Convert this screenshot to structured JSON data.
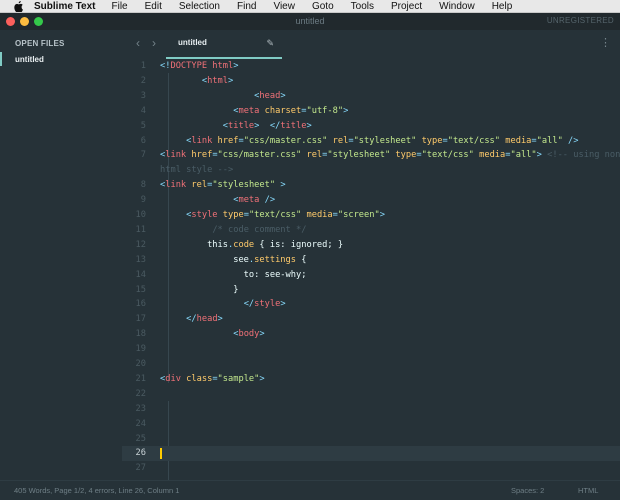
{
  "menubar": {
    "app": "Sublime Text",
    "items": [
      "File",
      "Edit",
      "Selection",
      "Find",
      "View",
      "Goto",
      "Tools",
      "Project",
      "Window",
      "Help"
    ]
  },
  "window": {
    "title": "untitled",
    "registration": "UNREGISTERED"
  },
  "sidebar": {
    "title": "OPEN FILES",
    "files": [
      "untitled"
    ]
  },
  "tab": {
    "label": "untitled"
  },
  "editor": {
    "current_line": 26,
    "lines": [
      {
        "n": "1",
        "tokens": [
          [
            "p",
            "<!"
          ],
          [
            "t",
            "DOCTYPE html"
          ],
          [
            "p",
            ">"
          ]
        ]
      },
      {
        "n": "2",
        "tokens": [
          [
            "x",
            "        "
          ],
          [
            "p",
            "<"
          ],
          [
            "t",
            "html"
          ],
          [
            "p",
            ">"
          ]
        ]
      },
      {
        "n": "3",
        "tokens": [
          [
            "x",
            "                  "
          ],
          [
            "p",
            "<"
          ],
          [
            "t",
            "head"
          ],
          [
            "p",
            ">"
          ]
        ]
      },
      {
        "n": "4",
        "tokens": [
          [
            "x",
            "              "
          ],
          [
            "p",
            "<"
          ],
          [
            "t",
            "meta "
          ],
          [
            "a",
            "charset"
          ],
          [
            "p",
            "="
          ],
          [
            "s",
            "\"utf-8\""
          ],
          [
            "p",
            ">"
          ]
        ]
      },
      {
        "n": "5",
        "tokens": [
          [
            "x",
            "            "
          ],
          [
            "p",
            "<"
          ],
          [
            "t",
            "title"
          ],
          [
            "p",
            ">  </"
          ],
          [
            "t",
            "title"
          ],
          [
            "p",
            ">"
          ]
        ]
      },
      {
        "n": "6",
        "tokens": [
          [
            "x",
            "     "
          ],
          [
            "p",
            "<"
          ],
          [
            "t",
            "link "
          ],
          [
            "a",
            "href"
          ],
          [
            "p",
            "="
          ],
          [
            "s",
            "\"css/master.css\""
          ],
          [
            "x",
            " "
          ],
          [
            "a",
            "rel"
          ],
          [
            "p",
            "="
          ],
          [
            "s",
            "\"stylesheet\""
          ],
          [
            "x",
            " "
          ],
          [
            "a",
            "type"
          ],
          [
            "p",
            "="
          ],
          [
            "s",
            "\"text/css\""
          ],
          [
            "x",
            " "
          ],
          [
            "a",
            "media"
          ],
          [
            "p",
            "="
          ],
          [
            "s",
            "\"all\""
          ],
          [
            "p",
            " />"
          ]
        ]
      },
      {
        "n": "7",
        "tokens": [
          [
            "p",
            "<"
          ],
          [
            "t",
            "link "
          ],
          [
            "a",
            "href"
          ],
          [
            "p",
            "="
          ],
          [
            "s",
            "\"css/master.css\""
          ],
          [
            "x",
            " "
          ],
          [
            "a",
            "rel"
          ],
          [
            "p",
            "="
          ],
          [
            "s",
            "\"stylesheet\""
          ],
          [
            "x",
            " "
          ],
          [
            "a",
            "type"
          ],
          [
            "p",
            "="
          ],
          [
            "s",
            "\"text/css\""
          ],
          [
            "x",
            " "
          ],
          [
            "a",
            "media"
          ],
          [
            "p",
            "="
          ],
          [
            "s",
            "\"all\""
          ],
          [
            "p",
            ">"
          ],
          [
            "c",
            " <!-- using non-"
          ]
        ]
      },
      {
        "n": "",
        "tokens": [
          [
            "c",
            "html style -->"
          ]
        ]
      },
      {
        "n": "8",
        "tokens": [
          [
            "p",
            "<"
          ],
          [
            "t",
            "link "
          ],
          [
            "a",
            "rel"
          ],
          [
            "p",
            "="
          ],
          [
            "s",
            "\"stylesheet\""
          ],
          [
            "p",
            " >"
          ]
        ]
      },
      {
        "n": "9",
        "tokens": [
          [
            "x",
            "              "
          ],
          [
            "p",
            "<"
          ],
          [
            "t",
            "meta"
          ],
          [
            "p",
            " />"
          ]
        ]
      },
      {
        "n": "10",
        "tokens": [
          [
            "x",
            "     "
          ],
          [
            "p",
            "<"
          ],
          [
            "t",
            "style "
          ],
          [
            "a",
            "type"
          ],
          [
            "p",
            "="
          ],
          [
            "s",
            "\"text/css\""
          ],
          [
            "x",
            " "
          ],
          [
            "a",
            "media"
          ],
          [
            "p",
            "="
          ],
          [
            "s",
            "\"screen\""
          ],
          [
            "p",
            ">"
          ]
        ]
      },
      {
        "n": "11",
        "tokens": [
          [
            "x",
            "          "
          ],
          [
            "c",
            "/* code comment */"
          ]
        ]
      },
      {
        "n": "12",
        "tokens": [
          [
            "x",
            "         this"
          ],
          [
            "p",
            "."
          ],
          [
            "a",
            "code"
          ],
          [
            "x",
            " { is: ignored; }"
          ]
        ]
      },
      {
        "n": "13",
        "tokens": [
          [
            "x",
            "              see"
          ],
          [
            "p",
            "."
          ],
          [
            "a",
            "settings"
          ],
          [
            "x",
            " {"
          ]
        ]
      },
      {
        "n": "14",
        "tokens": [
          [
            "x",
            "                to: see-why;"
          ]
        ]
      },
      {
        "n": "15",
        "tokens": [
          [
            "x",
            "              }"
          ]
        ]
      },
      {
        "n": "16",
        "tokens": [
          [
            "x",
            "                "
          ],
          [
            "p",
            "</"
          ],
          [
            "t",
            "style"
          ],
          [
            "p",
            ">"
          ]
        ]
      },
      {
        "n": "17",
        "tokens": [
          [
            "x",
            "     "
          ],
          [
            "p",
            "</"
          ],
          [
            "t",
            "head"
          ],
          [
            "p",
            ">"
          ]
        ]
      },
      {
        "n": "18",
        "tokens": [
          [
            "x",
            "              "
          ],
          [
            "p",
            "<"
          ],
          [
            "t",
            "body"
          ],
          [
            "p",
            ">"
          ]
        ]
      },
      {
        "n": "19",
        "tokens": []
      },
      {
        "n": "20",
        "tokens": []
      },
      {
        "n": "21",
        "tokens": [
          [
            "p",
            "<"
          ],
          [
            "t",
            "div "
          ],
          [
            "a",
            "class"
          ],
          [
            "p",
            "="
          ],
          [
            "s",
            "\"sample\""
          ],
          [
            "p",
            ">"
          ]
        ]
      },
      {
        "n": "22",
        "tokens": []
      },
      {
        "n": "23",
        "tokens": []
      },
      {
        "n": "24",
        "tokens": []
      },
      {
        "n": "25",
        "tokens": []
      },
      {
        "n": "26",
        "tokens": []
      },
      {
        "n": "27",
        "tokens": []
      }
    ]
  },
  "status": {
    "left": "405 Words, Page 1/2, 4 errors, Line 26, Column 1",
    "spaces": "Spaces: 2",
    "syntax": "HTML"
  },
  "colors": {
    "background": "#263238",
    "accent": "#80cbc4",
    "cursor": "#ffcc00",
    "tag": "#f07178",
    "attribute": "#ffcb6b",
    "string": "#c3e88d",
    "punctuation": "#89ddff",
    "comment": "#4a5d66"
  }
}
